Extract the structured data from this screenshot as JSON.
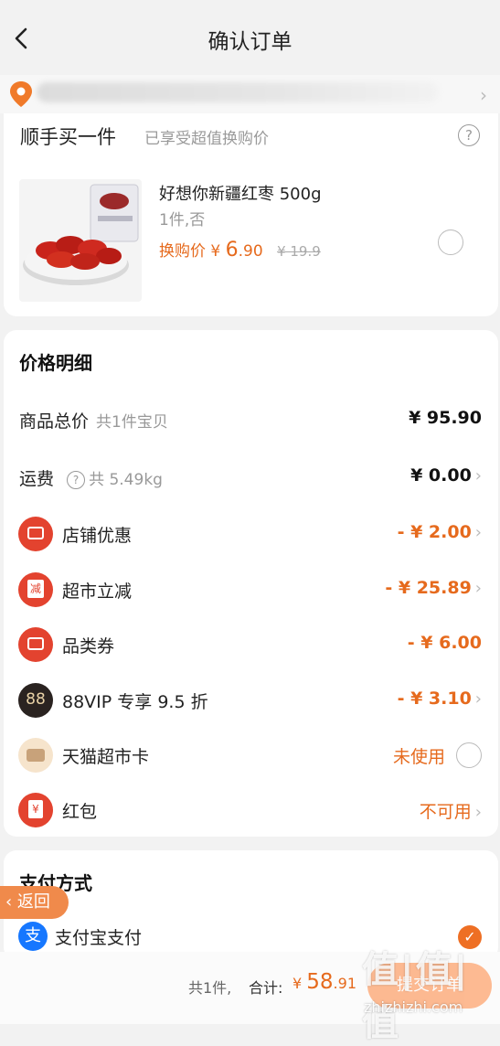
{
  "header": {
    "title": "确认订单"
  },
  "addon": {
    "title": "顺手买一件",
    "subtitle": "已享受超值换购价",
    "help_icon": "?",
    "product": {
      "name": "好想你新疆红枣 500g",
      "spec": "1件,否",
      "price_prefix": "换购价 ¥ ",
      "price_int": "6",
      "price_dec": ".90",
      "orig_price": "¥ 19.9"
    }
  },
  "price_detail": {
    "title": "价格明细",
    "goods_total": {
      "label": "商品总价",
      "sub": "共1件宝贝",
      "value": "¥ 95.90"
    },
    "shipping": {
      "label": "运费",
      "sub": "共 5.49kg",
      "value": "¥ 0.00"
    },
    "shop_discount": {
      "label": "店铺优惠",
      "value": "- ¥ 2.00"
    },
    "market_discount": {
      "label": "超市立减",
      "icon_text": "减",
      "value": "- ¥ 25.89"
    },
    "category_coupon": {
      "label": "品类券",
      "value": "- ¥ 6.00"
    },
    "vip": {
      "label": "88VIP 专享 9.5 折",
      "icon_text": "88",
      "value": "- ¥ 3.10"
    },
    "tmall_card": {
      "label": "天猫超市卡",
      "value": "未使用"
    },
    "red_packet": {
      "label": "红包",
      "icon_text": "¥",
      "value": "不可用"
    }
  },
  "payment": {
    "title": "支付方式",
    "method": {
      "label": "支付宝支付",
      "icon_text": "支"
    }
  },
  "float_back": {
    "label": "返回"
  },
  "footer": {
    "count": "共1件,",
    "total_label": "合计:",
    "currency": "¥ ",
    "amount_int": "58",
    "amount_dec": ".91",
    "submit": "提交订单"
  },
  "watermark": {
    "text": "值|值|值",
    "url": "zhizhizhi.com"
  },
  "colors": {
    "accent": "#e66a1d",
    "red_icon": "#e3432f",
    "alipay": "#1677ff"
  }
}
